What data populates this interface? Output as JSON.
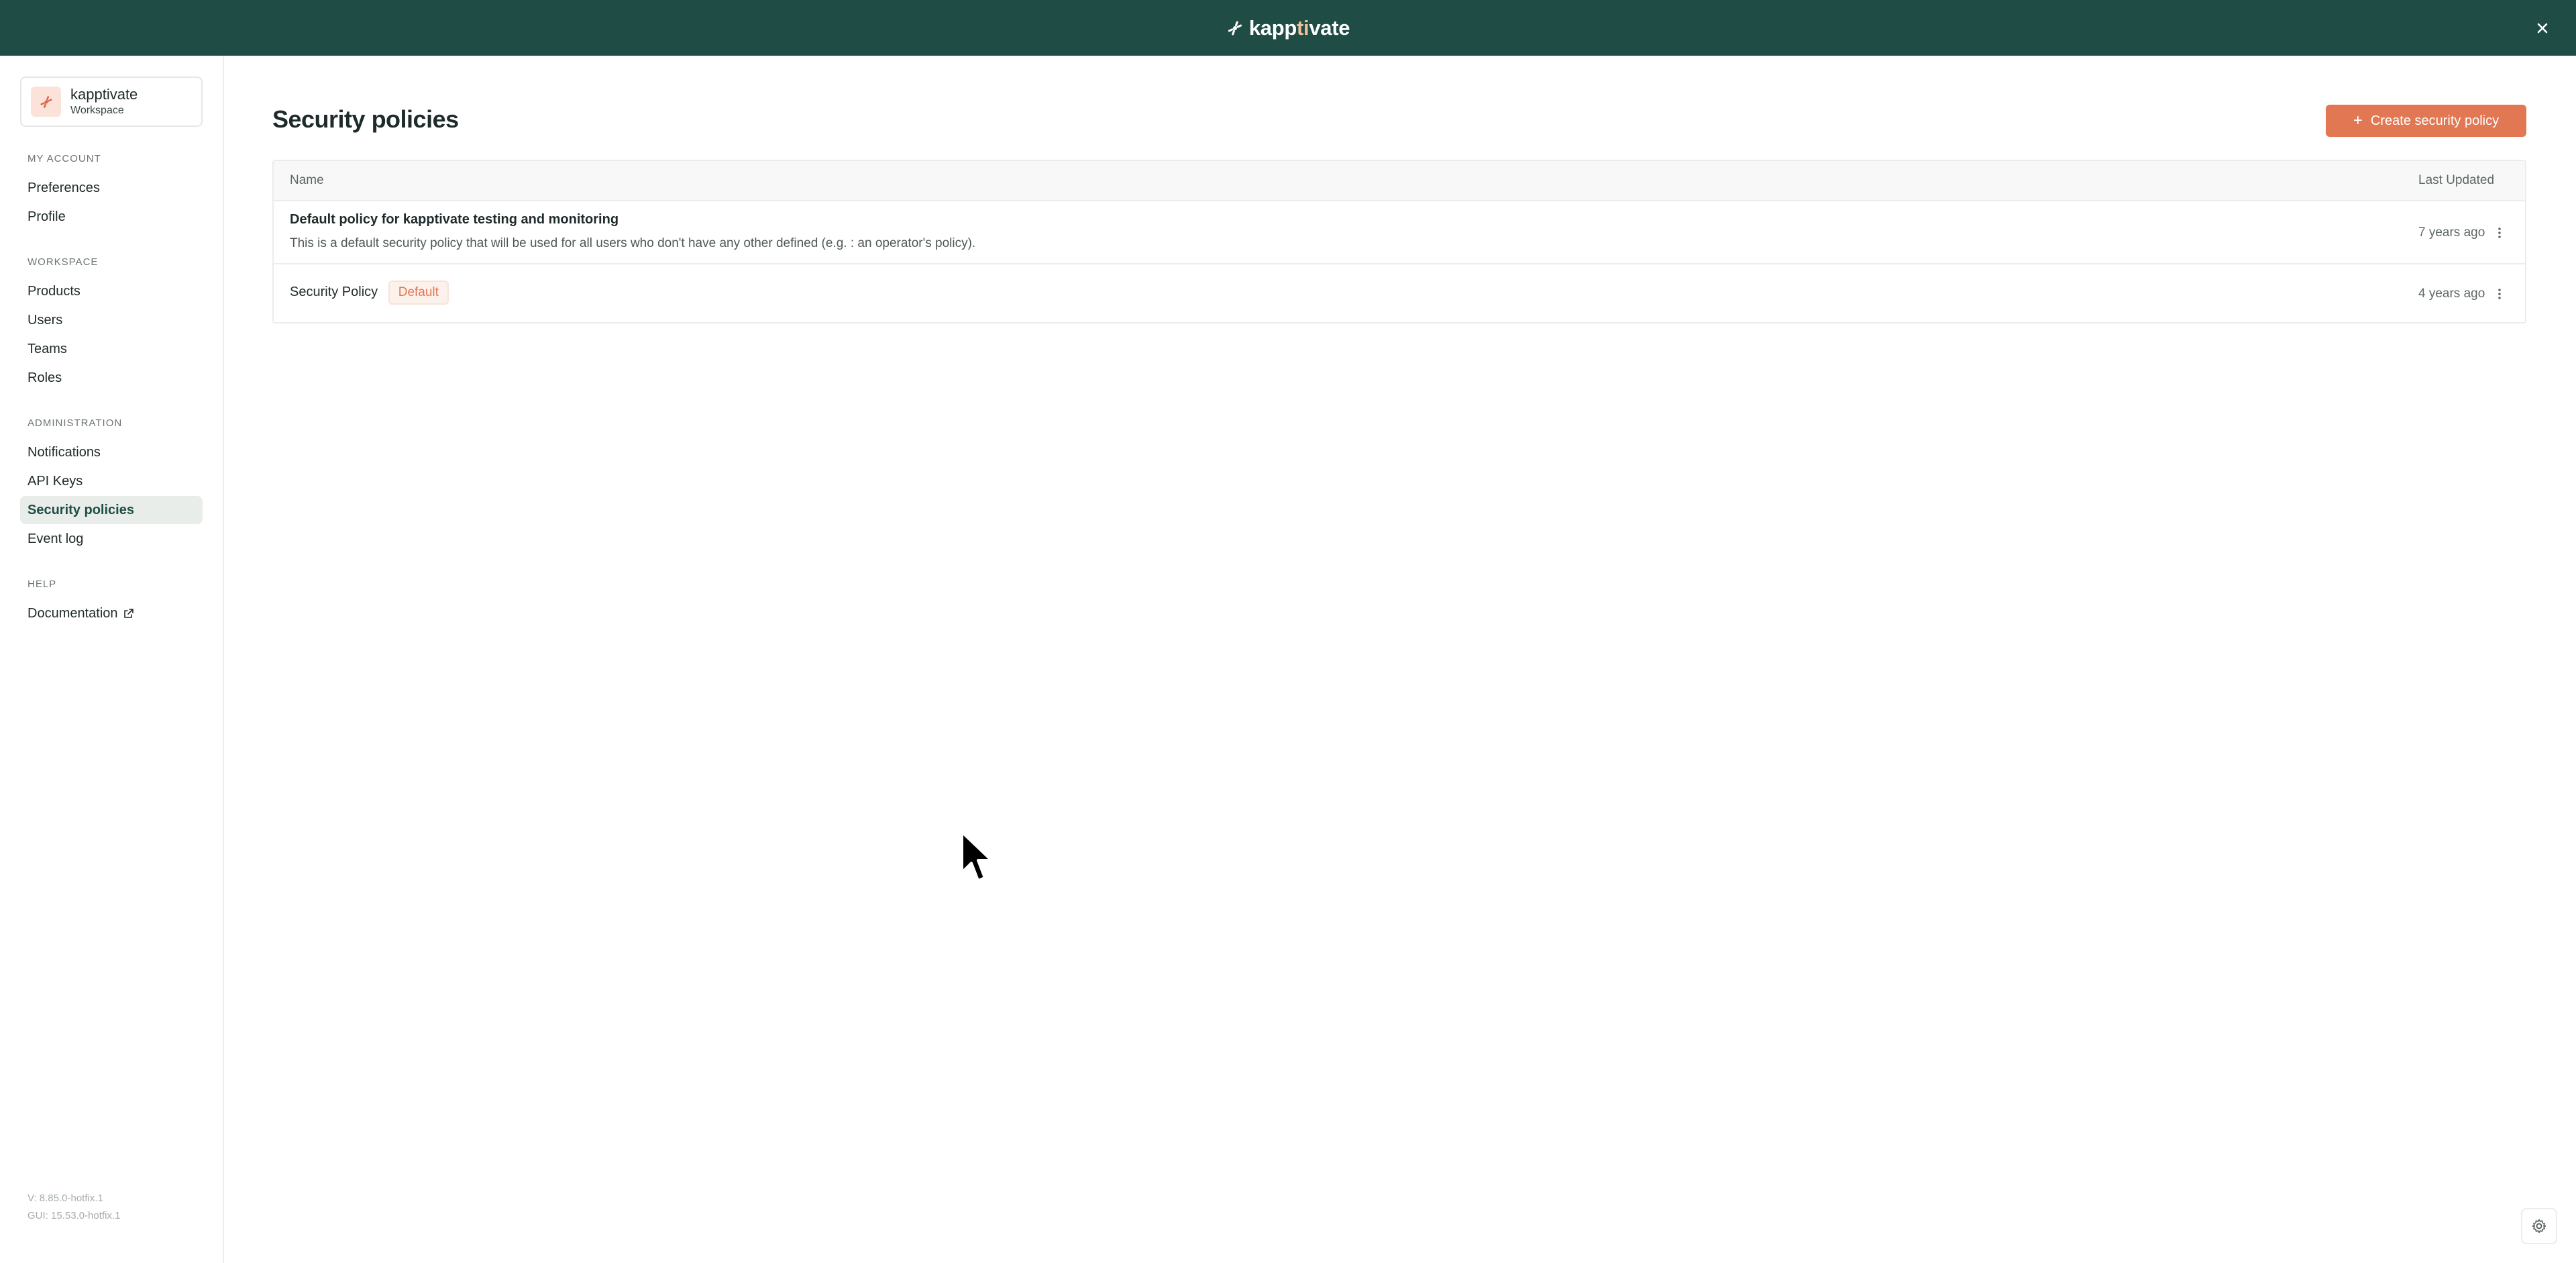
{
  "app": {
    "brand_prefix": "kapp",
    "brand_accent": "ti",
    "brand_suffix": "vate"
  },
  "workspace": {
    "name": "kapptivate",
    "type": "Workspace"
  },
  "sidebar": {
    "sections": [
      {
        "label": "MY ACCOUNT"
      },
      {
        "label": "WORKSPACE"
      },
      {
        "label": "ADMINISTRATION"
      },
      {
        "label": "HELP"
      }
    ],
    "items": [
      {
        "label": "Preferences"
      },
      {
        "label": "Profile"
      },
      {
        "label": "Products"
      },
      {
        "label": "Users"
      },
      {
        "label": "Teams"
      },
      {
        "label": "Roles"
      },
      {
        "label": "Notifications"
      },
      {
        "label": "API Keys"
      },
      {
        "label": "Security policies"
      },
      {
        "label": "Event log"
      },
      {
        "label": "Documentation"
      }
    ],
    "version": "V: 8.85.0-hotfix.1",
    "gui_version": "GUI: 15.53.0-hotfix.1"
  },
  "page": {
    "title": "Security policies",
    "create_label": "Create security policy"
  },
  "table": {
    "columns": [
      "Name",
      "Last Updated"
    ],
    "rows": [
      {
        "name": "Default policy for kapptivate testing and monitoring",
        "description": "This is a default security policy that will be used for all users who don't have any other defined (e.g. : an operator's policy).",
        "updated": "7 years ago"
      },
      {
        "name": "Security Policy",
        "badge": "Default",
        "updated": "4 years ago"
      }
    ]
  },
  "colors": {
    "topbar": "#1f4d45",
    "accent": "#e17753",
    "active_nav_bg": "#e8ede9"
  }
}
